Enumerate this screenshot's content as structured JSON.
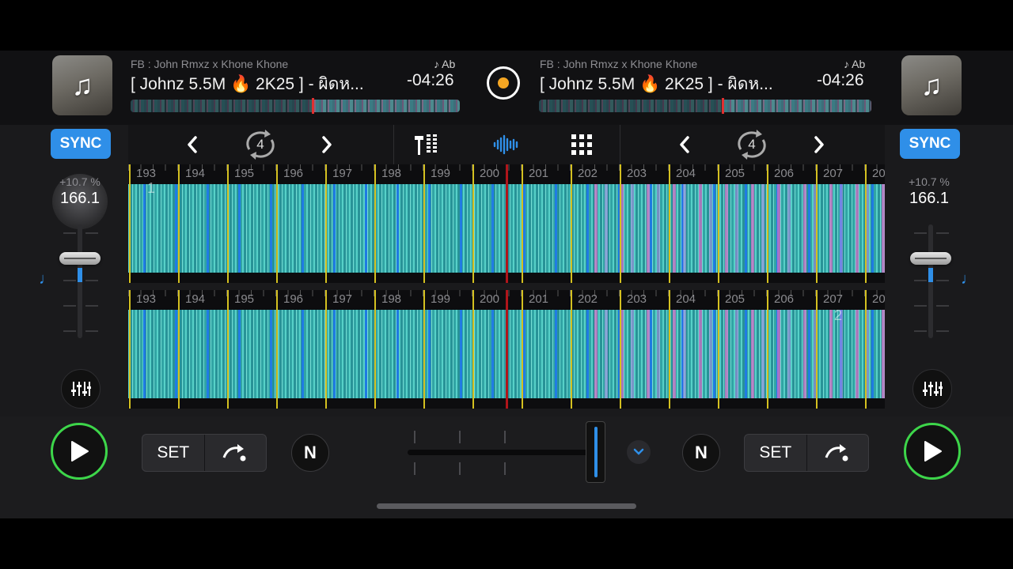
{
  "deckA": {
    "artist": "FB : John Rmxz x Khone Khone",
    "key": "♪ Ab",
    "title": "[ Johnz 5.5M 🔥 2K25 ] -  ผิดห...",
    "time": "-04:26",
    "sync": "SYNC",
    "pitch_pct": "+10.7 %",
    "bpm": "166.1",
    "loop_size": "4",
    "cue_set": "SET",
    "waveform_cue": "1",
    "progress": 0.55
  },
  "deckB": {
    "artist": "FB : John Rmxz x Khone Khone",
    "key": "♪ Ab",
    "title": "[ Johnz 5.5M 🔥 2K25 ] -  ผิดห...",
    "time": "-04:26",
    "sync": "SYNC",
    "pitch_pct": "+10.7 %",
    "bpm": "166.1",
    "loop_size": "4",
    "cue_set": "SET",
    "waveform_cue": "2",
    "progress": 0.55
  },
  "beat_numbers": [
    "193",
    "194",
    "195",
    "196",
    "197",
    "198",
    "199",
    "200",
    "201",
    "202",
    "203",
    "204",
    "205",
    "206",
    "207",
    "20"
  ],
  "crossfader": {
    "position": 1.0
  },
  "colors": {
    "accent": "#2f8fe8",
    "play": "#3dd64a",
    "playhead": "#b0151a",
    "record_dot": "#f5a623"
  },
  "icons": [
    "music-note-icon",
    "record-icon",
    "chevron-left-icon",
    "loop-icon",
    "chevron-right-icon",
    "mixer-icon",
    "waveform-icon",
    "grid-icon",
    "eq-icon",
    "play-icon",
    "cue-jump-icon",
    "neural-mix-icon",
    "chevron-down-icon"
  ]
}
